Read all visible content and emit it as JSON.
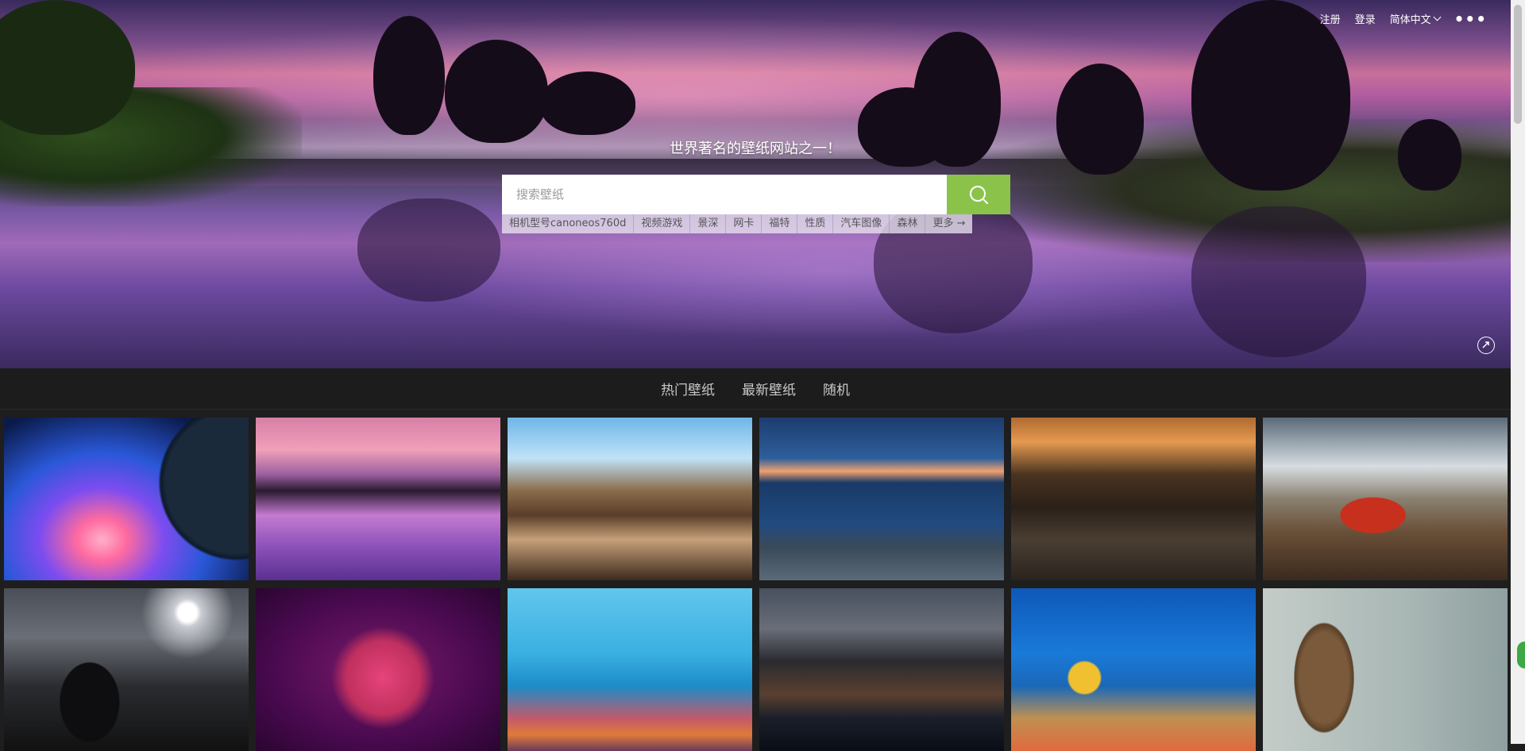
{
  "nav": {
    "register": "注册",
    "login": "登录",
    "language": "简体中文",
    "more": "•••"
  },
  "hero": {
    "slogan": "世界著名的壁纸网站之一！",
    "search_placeholder": "搜索壁纸",
    "tags": [
      "相机型号canoneos760d",
      "视频游戏",
      "景深",
      "网卡",
      "福特",
      "性质",
      "汽车图像",
      "森林",
      "更多 →"
    ]
  },
  "tabs": [
    "热门壁纸",
    "最新壁纸",
    "随机"
  ],
  "colors": {
    "accent": "#8bc34a",
    "tabbar": "#1c1c1c"
  },
  "thumbnails": [
    {
      "subject": "space-planet-nebula"
    },
    {
      "subject": "purple-lake-sunset"
    },
    {
      "subject": "anime-fantasy-town"
    },
    {
      "subject": "blue-sea-rocky-shore"
    },
    {
      "subject": "railway-through-forest"
    },
    {
      "subject": "red-car-on-dirt"
    },
    {
      "subject": "dark-woman-moonlight"
    },
    {
      "subject": "anime-girl-pink-hair"
    },
    {
      "subject": "underwater-coral-fish"
    },
    {
      "subject": "city-skyline-night"
    },
    {
      "subject": "coral-reef-tropical-fish"
    },
    {
      "subject": "old-wooden-boat"
    }
  ]
}
